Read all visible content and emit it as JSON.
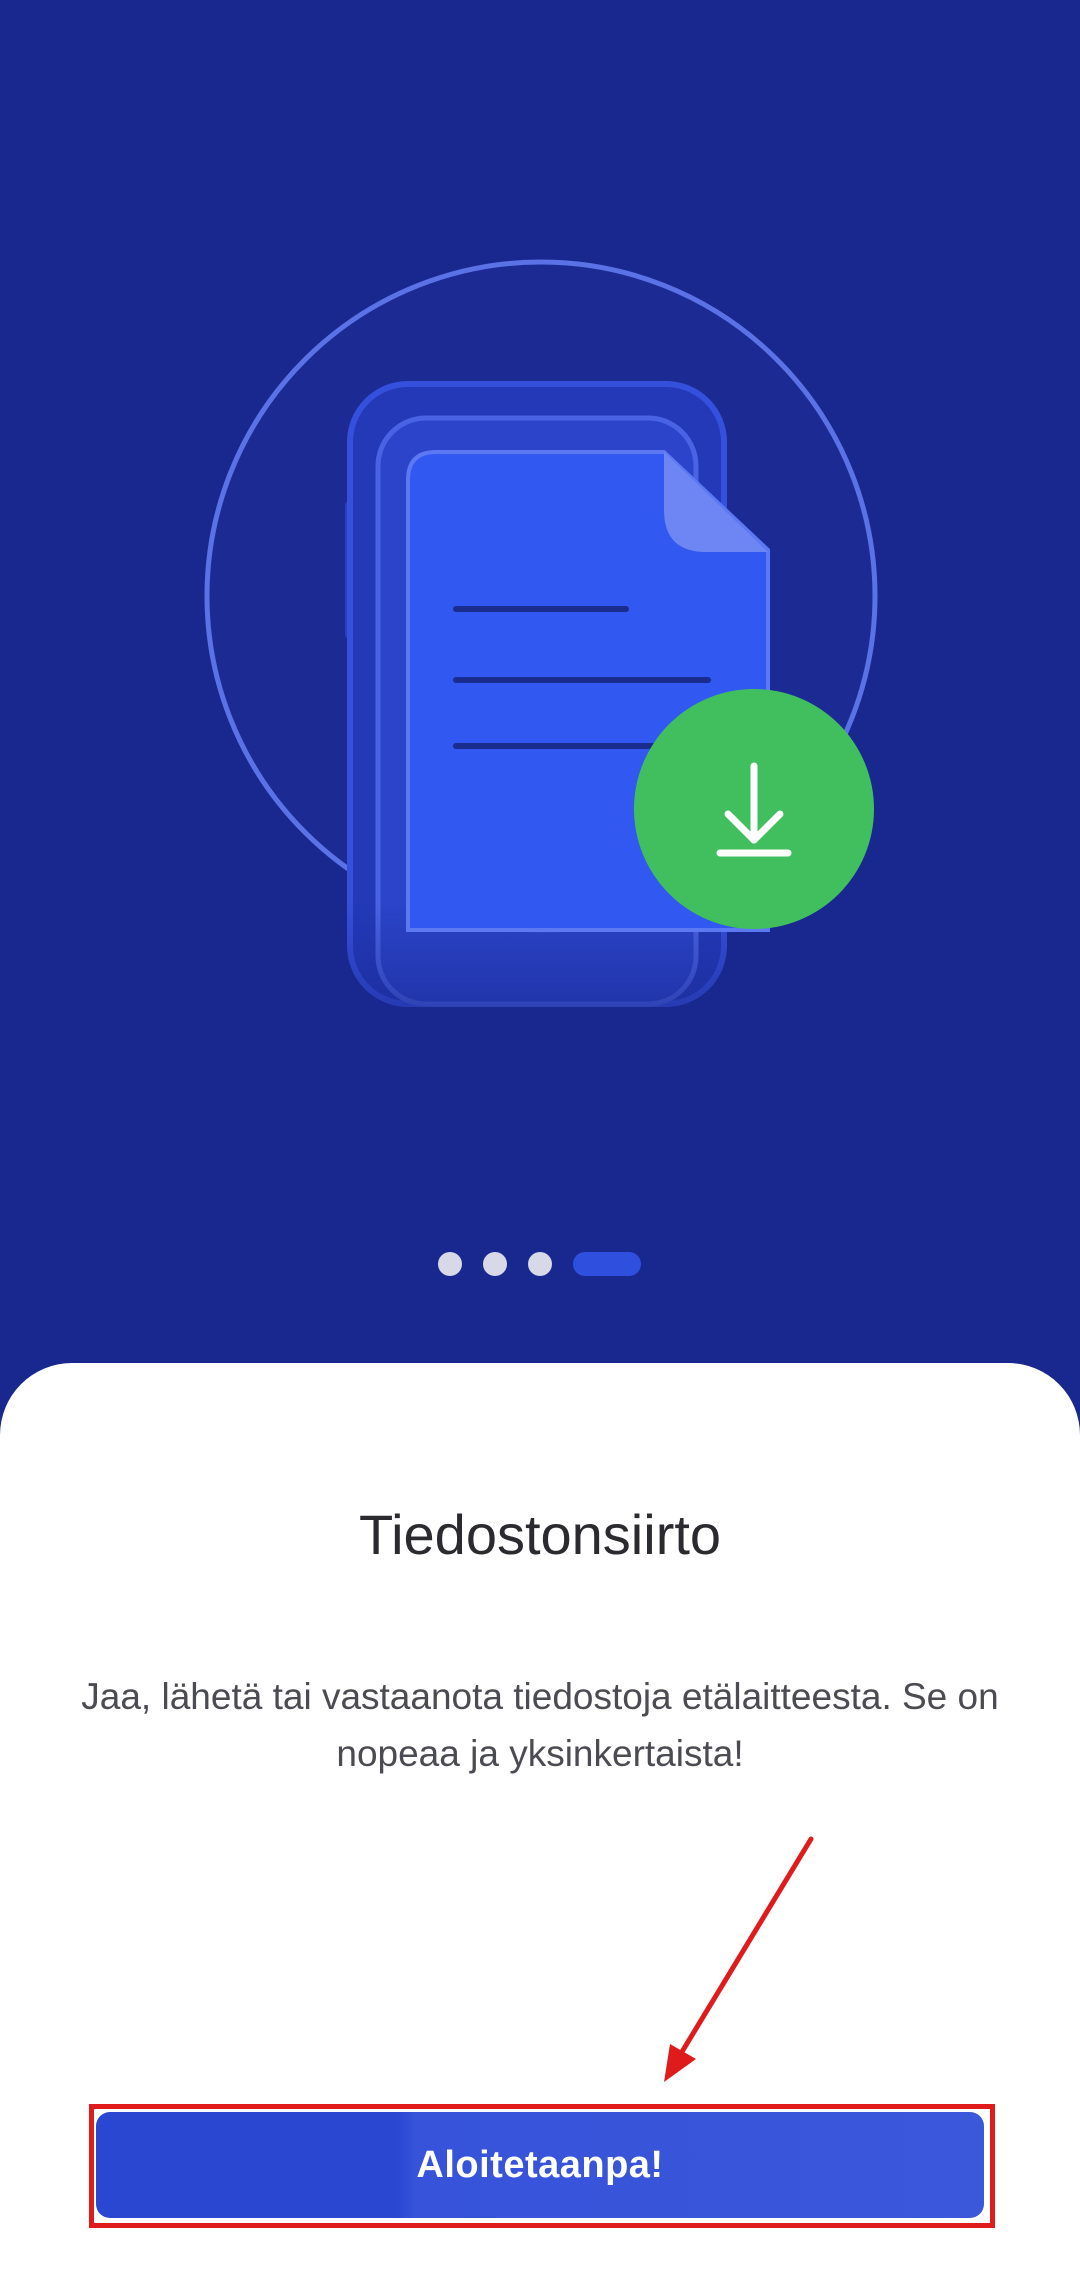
{
  "colors": {
    "background": "#19288E",
    "sheet": "#FFFFFF",
    "primary_button": "#2A47D2",
    "download_badge": "#41BF5F",
    "annotation": "#E01B1B"
  },
  "illustration": {
    "icons": [
      "document-icon",
      "download-icon"
    ]
  },
  "pager": {
    "total": 4,
    "active_index": 3
  },
  "onboarding": {
    "title": "Tiedostonsiirto",
    "description": "Jaa, lähetä tai vastaanota tiedostoja etälaitteesta. Se on nopeaa ja yksinkertaista!",
    "start_label": "Aloitetaanpa!"
  }
}
